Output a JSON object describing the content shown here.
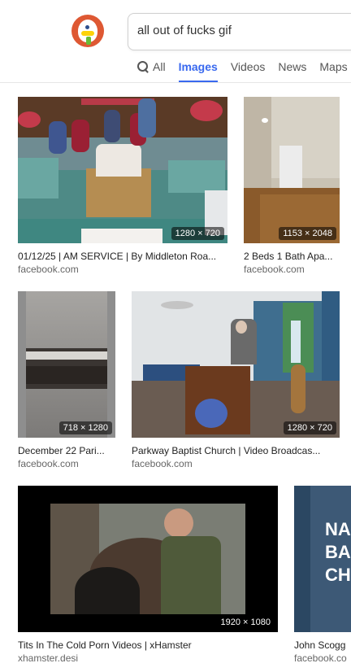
{
  "search": {
    "query": "all out of fucks gif"
  },
  "tabs": [
    {
      "label": "All"
    },
    {
      "label": "Images"
    },
    {
      "label": "Videos"
    },
    {
      "label": "News"
    },
    {
      "label": "Maps"
    }
  ],
  "results": [
    {
      "title": "01/12/25 | AM SERVICE | By Middleton Roa...",
      "source": "facebook.com",
      "dims": "1280 × 720"
    },
    {
      "title": "2 Beds 1 Bath Apa...",
      "source": "facebook.com",
      "dims": "1153 × 2048"
    },
    {
      "title": "December 22 Pari...",
      "source": "facebook.com",
      "dims": "718 × 1280"
    },
    {
      "title": "Parkway Baptist Church | Video Broadcas...",
      "source": "facebook.com",
      "dims": "1280 × 720"
    },
    {
      "title": "Tits In The Cold Porn Videos | xHamster",
      "source": "xhamster.desi",
      "dims": "1920 × 1080"
    },
    {
      "title": "John Scogg",
      "source": "facebook.co",
      "dims": "",
      "overlay_text": "NA BA CH"
    }
  ]
}
